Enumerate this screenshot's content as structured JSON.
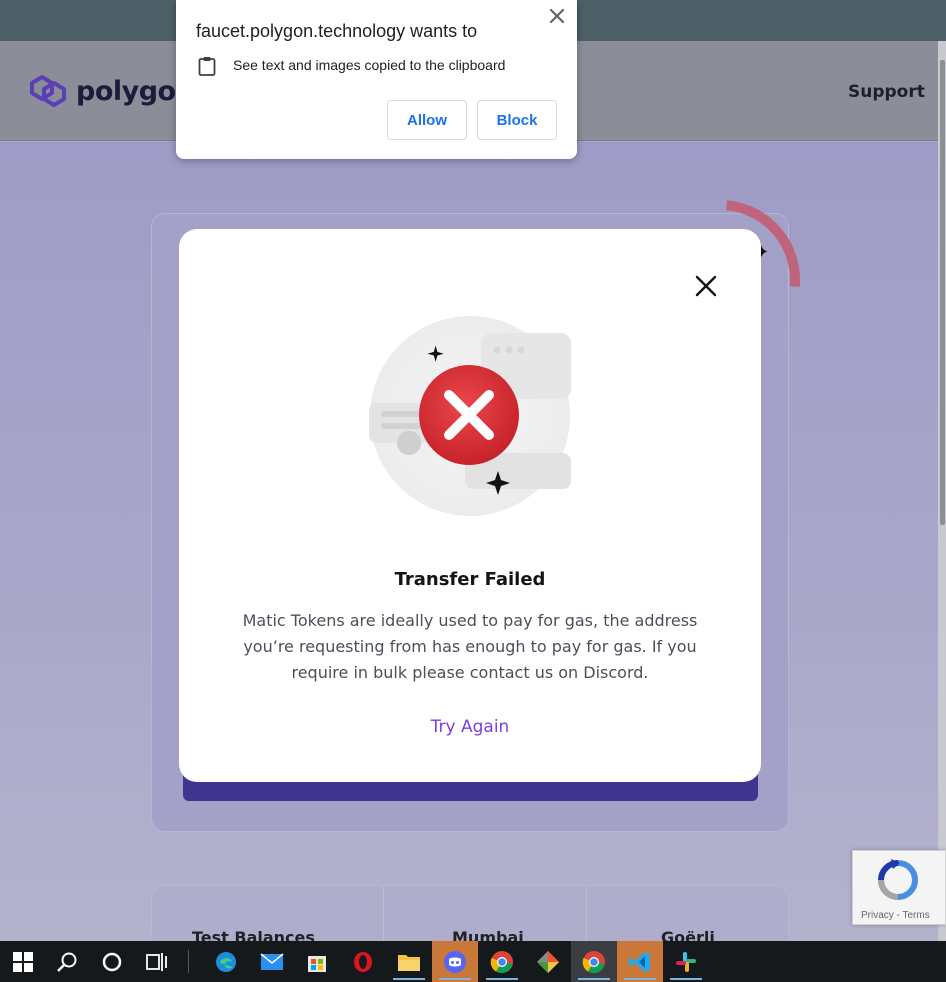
{
  "site": {
    "logo_text": "polygon",
    "nav_support": "Support"
  },
  "permission_popup": {
    "title": "faucet.polygon.technology wants to",
    "permission_text": "See text and images copied to the clipboard",
    "allow_label": "Allow",
    "block_label": "Block"
  },
  "modal": {
    "title": "Transfer Failed",
    "message": "Matic Tokens are ideally used to pay for gas, the address you’re requesting from has enough to pay for gas. If you require in bulk please contact us on Discord.",
    "action_label": "Try Again"
  },
  "balances": {
    "columns": [
      "Test Balances",
      "Mumbai",
      "Goërli"
    ]
  },
  "recaptcha": {
    "text": "Privacy - Terms"
  },
  "colors": {
    "accent_purple": "#7b3fe4",
    "error_red": "#d92d32",
    "link_blue": "#1a73e8",
    "submit_purple": "#3f3590"
  },
  "taskbar": {
    "icons": [
      "windows-start-icon",
      "search-icon",
      "cortana-icon",
      "task-view-icon",
      "edge-icon",
      "mail-icon",
      "store-icon",
      "opera-icon",
      "file-explorer-icon",
      "discord-icon",
      "chrome-icon",
      "git-icon",
      "chrome-icon",
      "vscode-icon",
      "slack-icon"
    ]
  }
}
